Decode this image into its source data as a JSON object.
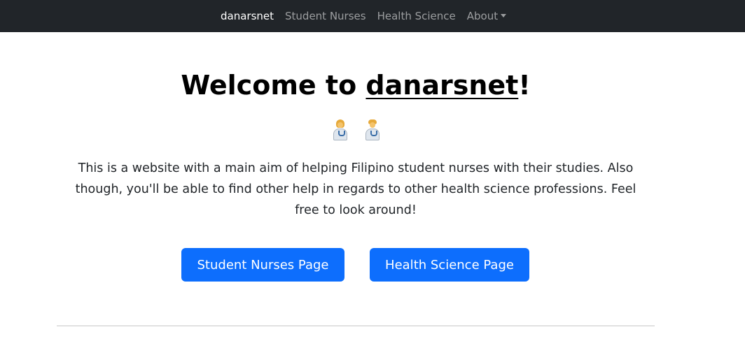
{
  "navbar": {
    "brand": "danarsnet",
    "links": [
      {
        "label": "Student Nurses"
      },
      {
        "label": "Health Science"
      },
      {
        "label": "About"
      }
    ]
  },
  "hero": {
    "title_prefix": "Welcome to ",
    "title_link": "danarsnet",
    "title_suffix": "!",
    "emoji_icons": [
      "woman-health-worker-icon",
      "man-health-worker-icon"
    ],
    "description": "This is a website with a main aim of helping Filipino student nurses with their studies. Also though, you'll be able to find other help in regards to other health science professions. Feel free to look around!",
    "buttons": {
      "nurses": "Student Nurses Page",
      "health": "Health Science Page"
    }
  },
  "colors": {
    "navbar_bg": "#212529",
    "primary_button": "#0d6efd",
    "text": "#212529"
  }
}
